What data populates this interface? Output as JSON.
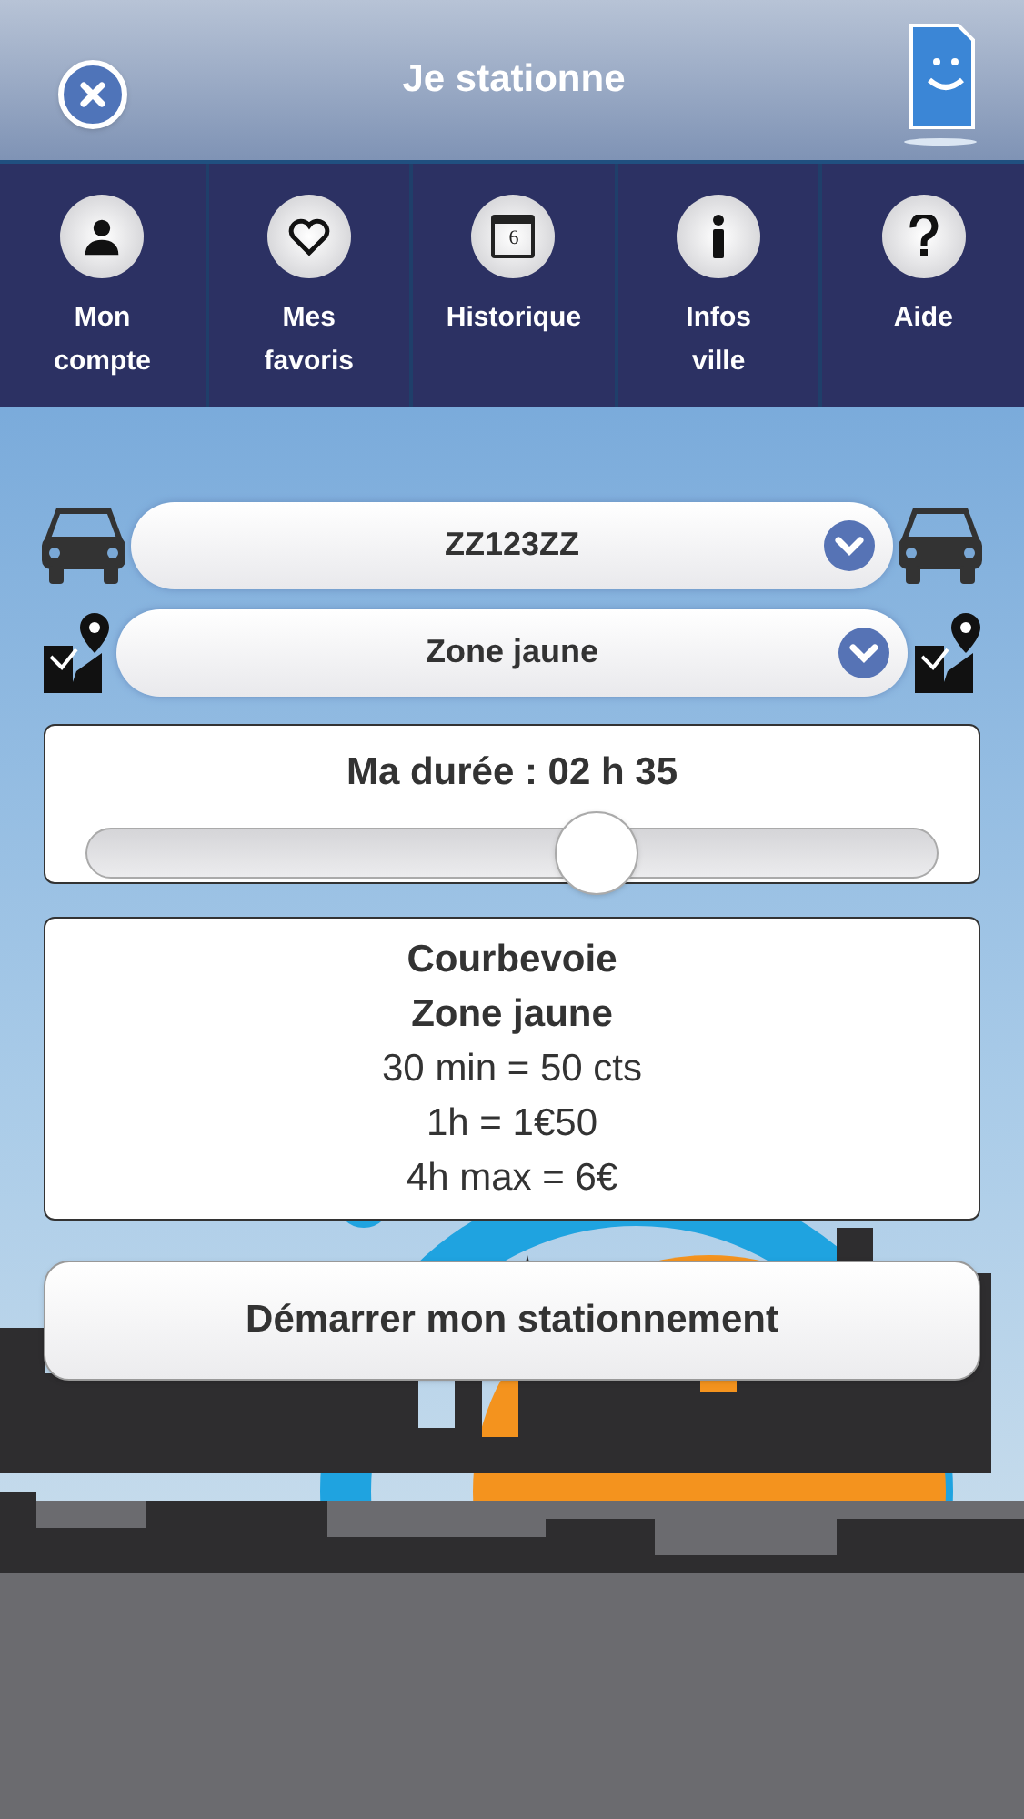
{
  "header": {
    "title": "Je stationne"
  },
  "nav": [
    {
      "kind": "account",
      "label": [
        "Mon",
        "compte"
      ]
    },
    {
      "kind": "favorites",
      "label": [
        "Mes",
        "favoris"
      ]
    },
    {
      "kind": "calendar",
      "icon_label": "6",
      "label": [
        "Historique"
      ]
    },
    {
      "kind": "info",
      "label": [
        "Infos",
        "ville"
      ]
    },
    {
      "kind": "help",
      "label": [
        "Aide"
      ]
    }
  ],
  "selects": [
    {
      "kind": "vehicle",
      "value": "ZZ123ZZ"
    },
    {
      "kind": "zone",
      "value": "Zone jaune"
    }
  ],
  "duration": {
    "label": "Ma durée : 02 h 35",
    "level": 0.6
  },
  "tariff": {
    "lines": [
      {
        "text": "Courbevoie",
        "bold": true
      },
      {
        "text": "Zone jaune",
        "bold": true
      },
      {
        "text": "30 min = 50 cts",
        "bold": false
      },
      {
        "text": "1h = 1€50",
        "bold": false
      },
      {
        "text": "4h max = 6€",
        "bold": false
      }
    ]
  },
  "start_button": "Démarrer mon stationnement"
}
